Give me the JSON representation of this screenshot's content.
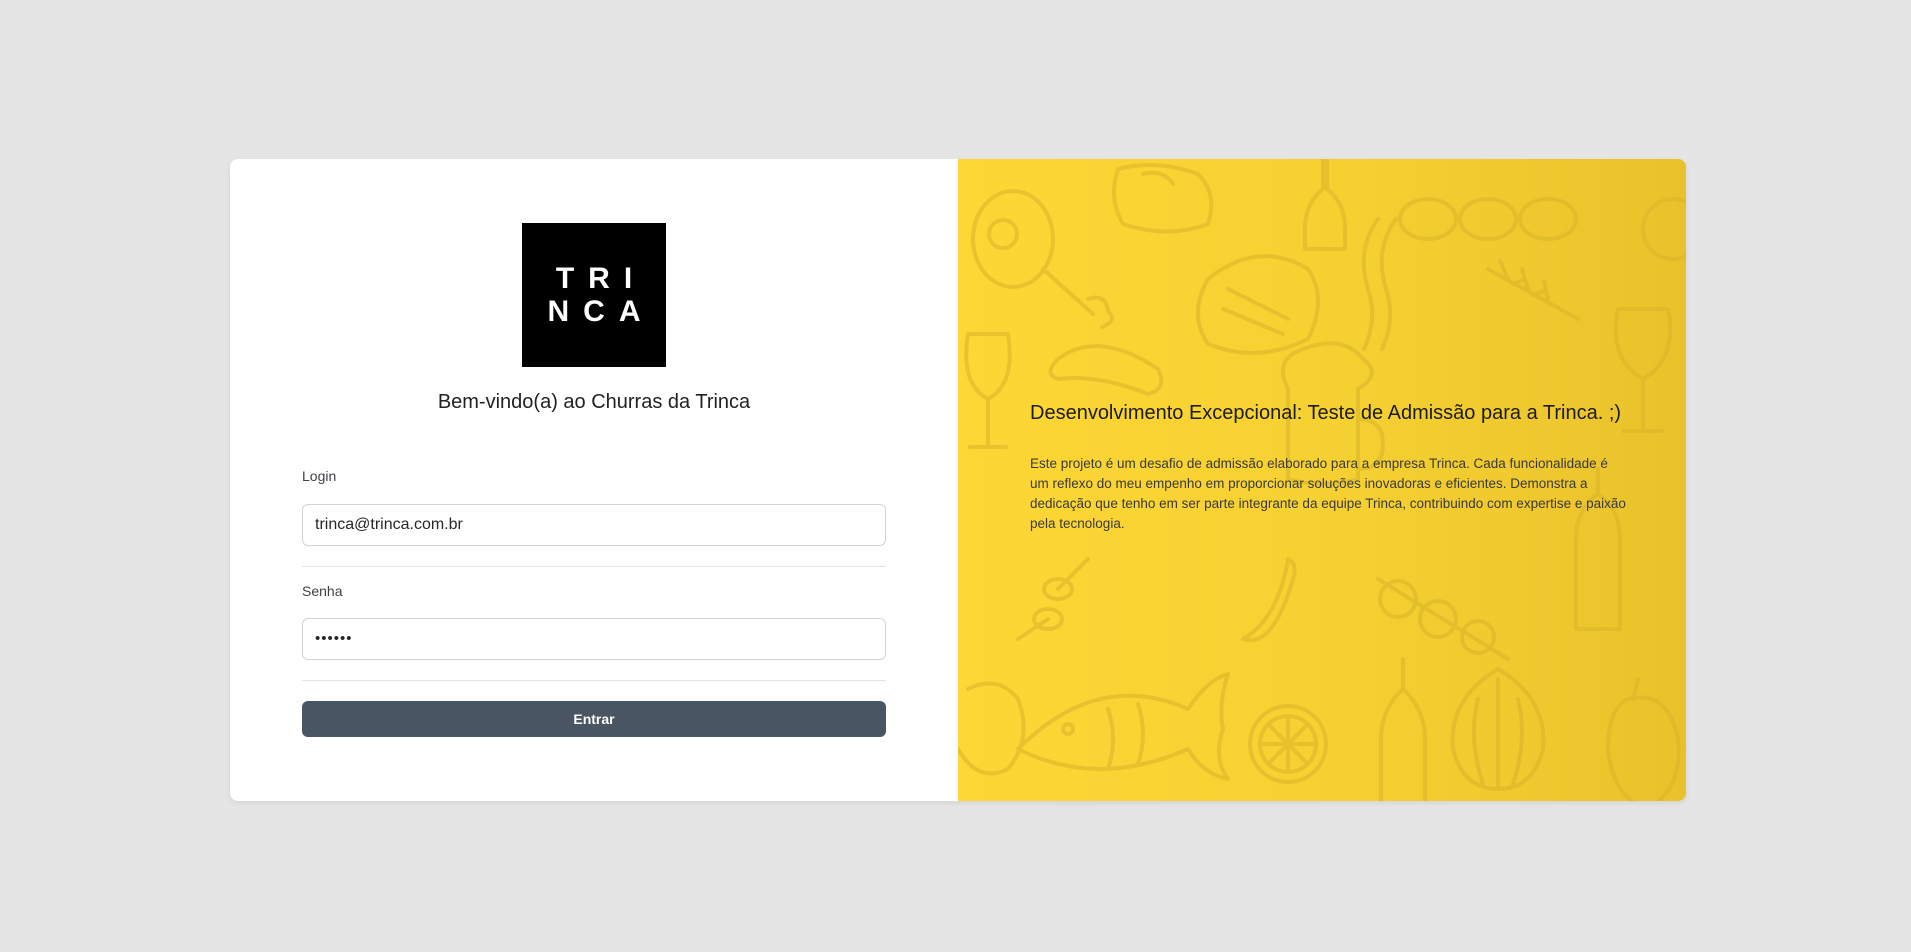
{
  "logo": {
    "line1": "TRI",
    "line2": "NCA"
  },
  "welcome_text": "Bem-vindo(a) ao Churras da Trinca",
  "form": {
    "login_label": "Login",
    "login_value": "trinca@trinca.com.br",
    "password_label": "Senha",
    "password_value": "••••••",
    "submit_label": "Entrar"
  },
  "info": {
    "title": "Desenvolvimento Excepcional: Teste de Admissão para a Trinca. ;)",
    "description": "Este projeto é um desafio de admissão elaborado para a empresa Trinca. Cada funcionalidade é um reflexo do meu empenho em proporcionar soluções inovadoras e eficientes. Demonstra a dedicação que tenho em ser parte integrante da equipe Trinca, contribuindo com expertise e paixão pela tecnologia."
  },
  "colors": {
    "background": "#e5e5e5",
    "panel_yellow": "#f5d031",
    "button": "#4a5563",
    "logo_bg": "#000000"
  },
  "icons": {
    "pattern": "bbq-food-doodle-pattern"
  }
}
